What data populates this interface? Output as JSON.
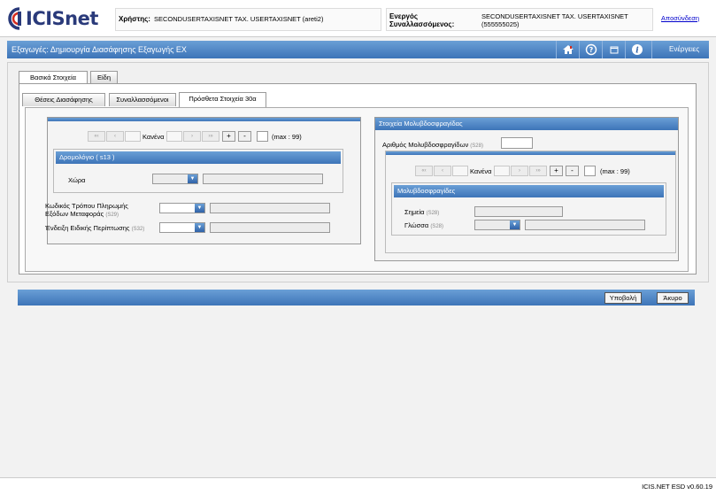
{
  "header": {
    "logo_text": "ICISnet",
    "user_label": "Χρήστης:",
    "user_value": "SECONDUSERTAXISNET TAX. USERTAXISNET (areti2)",
    "entity_label_line1": "Ενεργός",
    "entity_label_line2": "Συναλλασσόμενος:",
    "entity_value_line1": "SECONDUSERTAXISNET TAX. USERTAXISNET",
    "entity_value_line2": "(555555025)",
    "logout": "Αποσύνδεση"
  },
  "titlebar": {
    "title": "Εξαγωγές: Δημιουργία Διασάφησης Εξαγωγής ΕΧ",
    "actions": "Ενέργειες"
  },
  "tabs": {
    "main": [
      "Βασικά Στοιχεία",
      "Είδη"
    ],
    "sub": [
      "Θέσεις Διασάφησης",
      "Συναλλασσόμενοι",
      "Πρόσθετα Στοιχεία 30α"
    ]
  },
  "left": {
    "nav_none": "Κανένα",
    "nav_max": "(max : 99)",
    "plus": "+",
    "minus": "-",
    "route_header": "Δρομολόγιο ( s13 )",
    "country_label": "Χώρα",
    "payment_label_line1": "Κωδικός Τρόπου Πληρωμής",
    "payment_label_line2": "Εξόδων Μεταφοράς",
    "payment_code": "(S29)",
    "special_label": "Ένδειξη Ειδικής Περίπτωσης",
    "special_code": "(S32)"
  },
  "right": {
    "header": "Στοιχεία Μολυβδοσφραγίδας",
    "seals_count_label": "Αριθμός Μολυβδοσφραγίδων",
    "seals_count_code": "(S28)",
    "nav_none": "Κανένα",
    "nav_max": "(max : 99)",
    "plus": "+",
    "minus": "-",
    "seals_header": "Μολυβδοσφραγίδες",
    "mark_label": "Σημεία",
    "mark_code": "(S28)",
    "lang_label": "Γλώσσα",
    "lang_code": "(S28)"
  },
  "buttons": {
    "submit": "Υποβολή",
    "cancel": "Άκυρο"
  },
  "footer": {
    "version": "ICIS.NET ESD v0.60.19"
  },
  "colors": {
    "accent_blue": "#3d74b8",
    "logo_blue": "#2a3a7a",
    "logo_red": "#d52b1e"
  }
}
